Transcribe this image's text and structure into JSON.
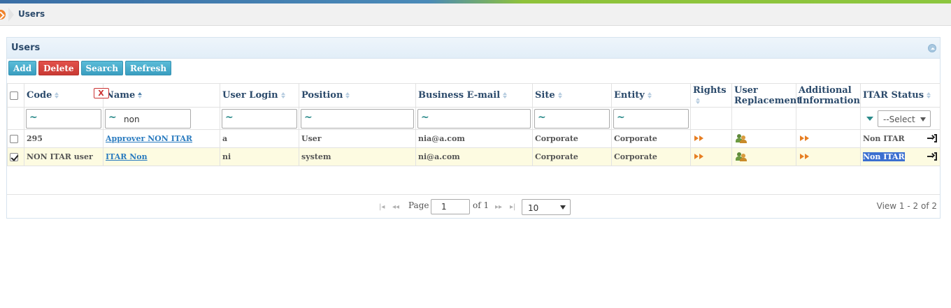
{
  "breadcrumb": {
    "current": "Users"
  },
  "panel": {
    "title": "Users"
  },
  "toolbar": {
    "add": "Add",
    "delete": "Delete",
    "search": "Search",
    "refresh": "Refresh"
  },
  "columns": {
    "code": "Code",
    "name": "Name",
    "user_login": "User Login",
    "position": "Position",
    "business_email": "Business E-mail",
    "site": "Site",
    "entity": "Entity",
    "rights": "Rights",
    "user_replacement": "User Replacement",
    "additional_information": "Additional Information",
    "itar_status": "ITAR Status"
  },
  "filters": {
    "tilde": "~",
    "name_value": "non",
    "clear": "X",
    "itar_select": "--Select--"
  },
  "rows": [
    {
      "selected": false,
      "code": "295",
      "name": "Approver NON ITAR",
      "login": "a",
      "position": "User",
      "email": "nia@a.com",
      "site": "Corporate",
      "entity": "Corporate",
      "itar": "Non ITAR"
    },
    {
      "selected": true,
      "code": "NON ITAR user",
      "name": "ITAR Non",
      "login": "ni",
      "position": "system",
      "email": "ni@a.com",
      "site": "Corporate",
      "entity": "Corporate",
      "itar": "Non ITAR"
    }
  ],
  "pager": {
    "first": "|◂",
    "prev": "◂◂",
    "page_label": "Page",
    "page_value": "1",
    "of_label": "of 1",
    "next": "▸▸",
    "last": "▸|",
    "rows_per_page": "10",
    "view_count": "View 1 - 2 of 2"
  }
}
